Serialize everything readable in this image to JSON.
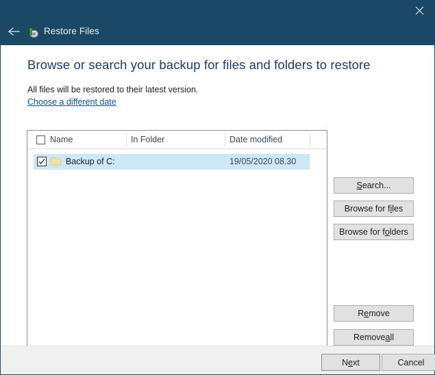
{
  "window": {
    "title": "Restore Files",
    "title_icon": "restore-disk-icon",
    "back_icon": "back-arrow-icon",
    "close_icon": "close-icon",
    "titlebar_color": "#1b4965"
  },
  "page": {
    "heading": "Browse or search your backup for files and folders to restore",
    "subtitle": "All files will be restored to their latest version.",
    "link": "Choose a different date",
    "link_color": "#0b4fa5",
    "heading_color": "#1a3c73"
  },
  "listview": {
    "columns": [
      {
        "label": "Name"
      },
      {
        "label": "In Folder"
      },
      {
        "label": "Date modified"
      }
    ],
    "header_checkbox_checked": false,
    "rows": [
      {
        "checked": true,
        "icon": "folder-icon",
        "name": "Backup of C:",
        "in_folder": "",
        "date_modified": "19/05/2020 08.30",
        "selected": true,
        "selection_color": "#cce8f7"
      }
    ]
  },
  "side_buttons": [
    {
      "id": "search",
      "text_before": "",
      "accel": "S",
      "text_after": "earch..."
    },
    {
      "id": "browse-files",
      "text_before": "Browse for f",
      "accel": "i",
      "text_after": "les"
    },
    {
      "id": "browse-folders",
      "text_before": "Browse for f",
      "accel": "o",
      "text_after": "lders"
    },
    {
      "id": "remove",
      "text_before": "R",
      "accel": "e",
      "text_after": "move"
    },
    {
      "id": "remove-all",
      "text_before": "Remove ",
      "accel": "a",
      "text_after": "ll"
    }
  ],
  "footer_buttons": [
    {
      "id": "next",
      "text_before": "N",
      "accel": "e",
      "text_after": "xt",
      "default": true
    },
    {
      "id": "cancel",
      "text_before": "Cancel",
      "accel": "",
      "text_after": "",
      "default": false
    }
  ]
}
